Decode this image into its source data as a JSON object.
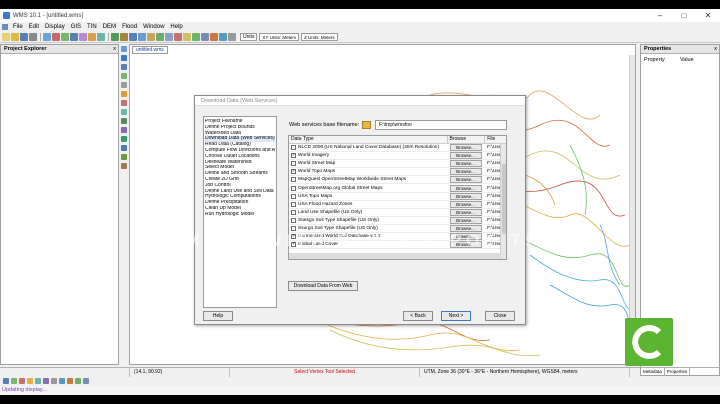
{
  "window": {
    "title": "WMS 10.1 - [untitled.wms]",
    "controls": {
      "minimize": "–",
      "maximize": "□",
      "close": "✕"
    }
  },
  "menubar": {
    "items": [
      "File",
      "Edit",
      "Display",
      "GIS",
      "TIN",
      "DEM",
      "Flood",
      "Window",
      "Help"
    ]
  },
  "toolbar": {
    "units_label": "Units",
    "unit_xy": "XY Units: Meters",
    "unit_z": "Z Units: Meters"
  },
  "project_explorer": {
    "title": "Project Explorer",
    "close": "x"
  },
  "doc_tab": {
    "label": "untitled.wms"
  },
  "properties": {
    "title": "Properties",
    "close": "x",
    "col_property": "Property",
    "col_value": "Value",
    "tab_metadata": "Metadata",
    "tab_properties": "Properties"
  },
  "dialog": {
    "title": "Download Data (Web Services)",
    "steps": [
      "Project Filename",
      "Define Project Bounds",
      "Watershed Data",
      "Download Data (Web Services)",
      "Read Data (Catalog)",
      "Compute Flow Directions and Ac",
      "Choose Outlet Locations",
      "Delineate Watershed",
      "Select Model",
      "Define and Smooth Streams",
      "Create 2D Grid",
      "Job Control",
      "Define Land Use and Soil Data",
      "Hydrologic Computations",
      "Define Precipitation",
      "Clean Up Model",
      "Run Hydrologic Model"
    ],
    "active_step": 3,
    "base_filename_label": "Web services base filename:",
    "base_filename_value": "F:\\tmp\\wmsfoo",
    "table": {
      "col_data_type": "Data Type",
      "col_browse": "Browse",
      "col_file": "File",
      "rows": [
        {
          "checked": false,
          "label": "NLCD 2006 (US National Land Cover Database) (30m Resolution)",
          "browse": "Browse...",
          "file": "F:\\Use"
        },
        {
          "checked": true,
          "label": "World Imagery",
          "browse": "Browse...",
          "file": "F:\\Use"
        },
        {
          "checked": false,
          "label": "World Street Map",
          "browse": "Browse...",
          "file": "F:\\Use"
        },
        {
          "checked": true,
          "label": "World Topo Maps",
          "browse": "Browse...",
          "file": "F:\\Use"
        },
        {
          "checked": false,
          "label": "MapQuest OpenStreetMap Worldwide Street Maps",
          "browse": "Browse...",
          "file": "F:\\Use"
        },
        {
          "checked": false,
          "label": "OpenStreetMap.org Global Street Maps",
          "browse": "Browse...",
          "file": "F:\\Use"
        },
        {
          "checked": false,
          "label": "USA Topo Maps",
          "browse": "Browse...",
          "file": "F:\\Use"
        },
        {
          "checked": false,
          "label": "USA Flood Hazard Zones",
          "browse": "Browse...",
          "file": "F:\\Use"
        },
        {
          "checked": false,
          "label": "Land Use Shapefile (US Only)",
          "browse": "Browse...",
          "file": "F:\\Use"
        },
        {
          "checked": false,
          "label": "Statsgo Soil Type Shapefile (US Only)",
          "browse": "Browse...",
          "file": "F:\\Use"
        },
        {
          "checked": false,
          "label": "Ssurgo Soil Type Shapefile (US Only)",
          "browse": "Browse...",
          "file": "F:\\Use"
        },
        {
          "checked": true,
          "label": "Harmonized World Soil Database v 1.2",
          "browse": "Browse...",
          "file": "F:\\Use"
        },
        {
          "checked": true,
          "label": "Global Land Cover",
          "browse": "Browse...",
          "file": "F:\\Use"
        }
      ]
    },
    "download_button": "Download Data From Web",
    "help_button": "Help",
    "back_button": "< Back",
    "next_button": "Next >",
    "close_button": "Close"
  },
  "watermark": "MADE WITH BLA SIA POE TIM",
  "statusbar": {
    "coords": "(14.1, 90.92)",
    "message": "Select Vertex Tool Selected",
    "projection": "UTM, Zone 36 (30°E - 36°E - Northern Hemisphere), WGS84, meters"
  },
  "update_text": "Updating display...",
  "colors": {
    "accent": "#3b7ac4",
    "status_message": "#cc0000",
    "update_text": "#7a3bb5",
    "recorder_logo": "#5cb531"
  }
}
